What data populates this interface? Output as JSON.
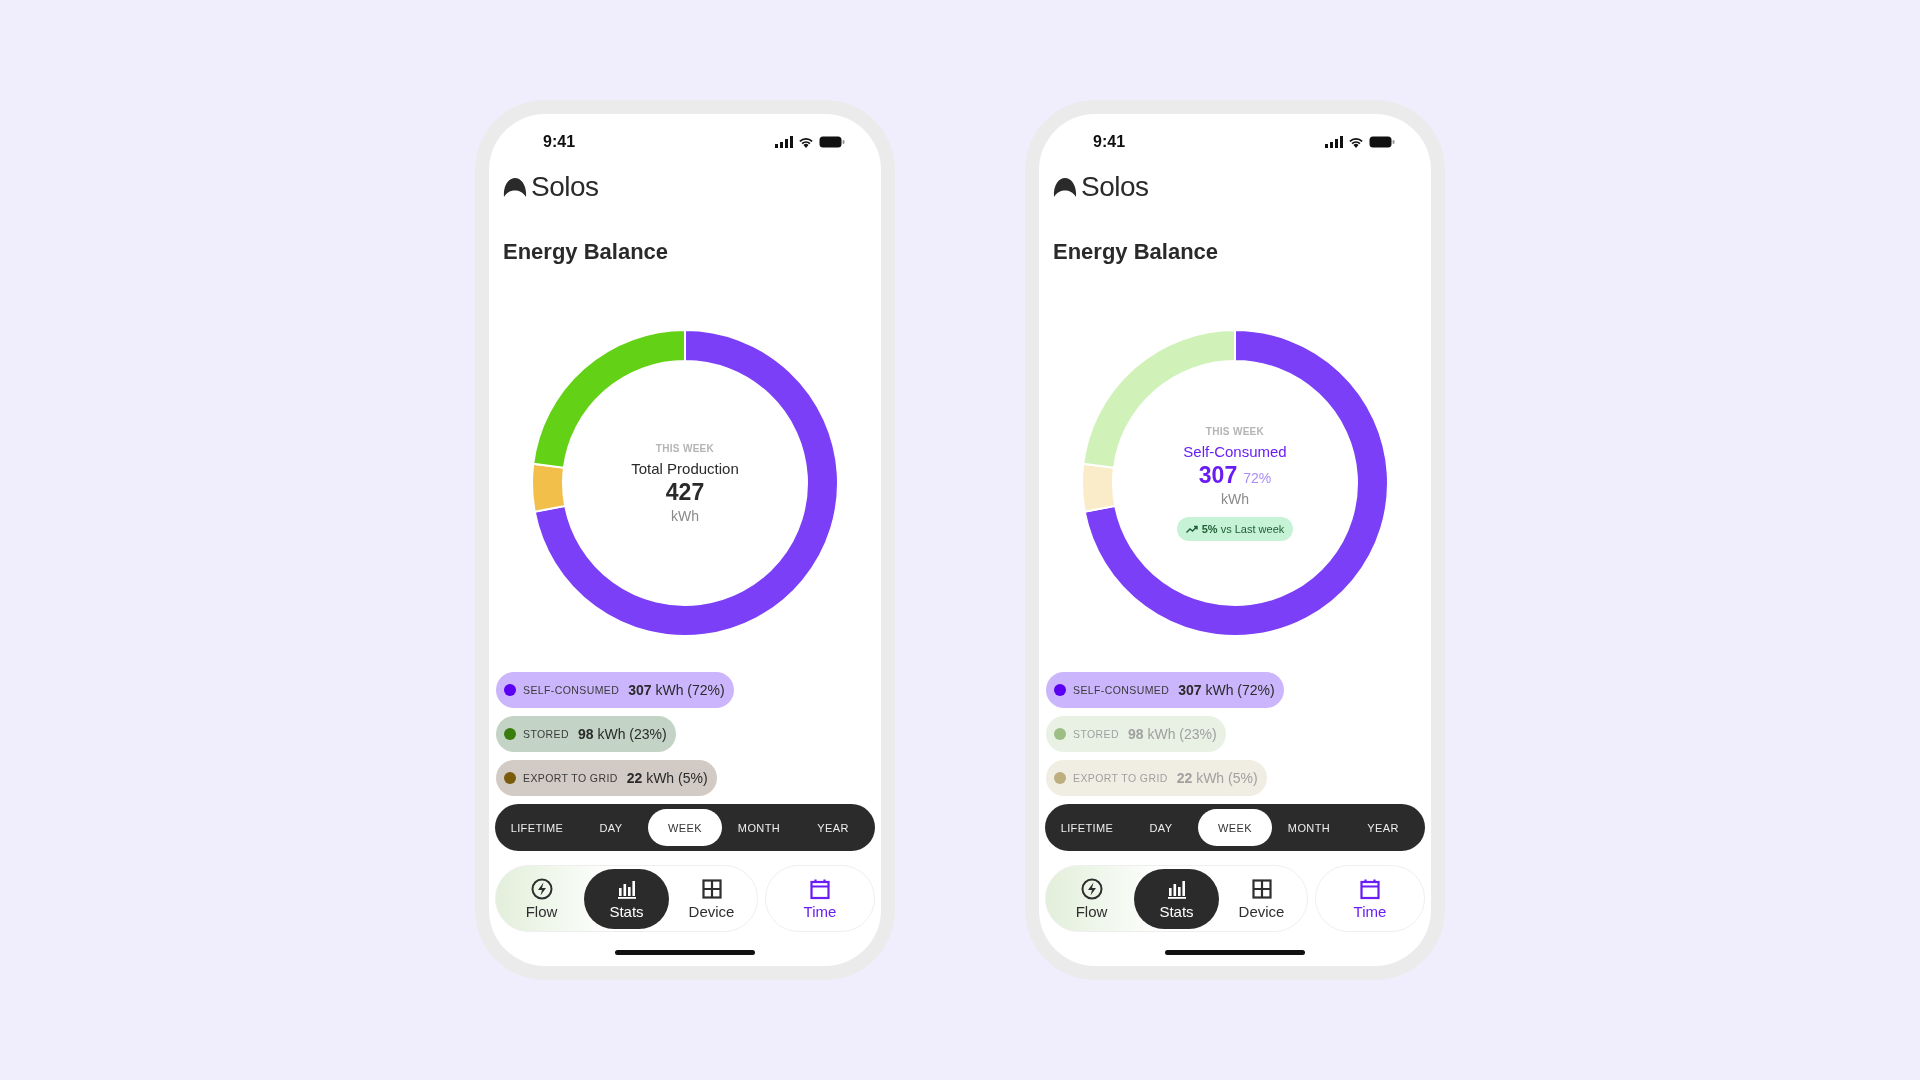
{
  "phones": [
    {
      "status_bar": {
        "time": "9:41"
      },
      "app": {
        "name": "Solos"
      },
      "title": "Energy Balance",
      "chart_data": {
        "type": "donut",
        "values": [
          72,
          5,
          23
        ],
        "colors": [
          "#7b3ff7",
          "#f2bf4b",
          "#63d115"
        ]
      },
      "slices": [
        {
          "dimmed": false
        },
        {
          "dimmed": false
        },
        {
          "dimmed": false
        }
      ],
      "center": {
        "kind": "total",
        "caption": "THIS WEEK",
        "label": "Total Production",
        "value": "427",
        "unit": "kWh"
      },
      "legend": [
        {
          "label": "SELF-CONSUMED",
          "value": "307 kWh (72%)",
          "color": "#5b00f2",
          "dimmed": false
        },
        {
          "label": "STORED",
          "value": "98 kWh (23%)",
          "color": "#3a7d0f",
          "dimmed": false
        },
        {
          "label": "EXPORT TO GRID",
          "value": "22 kWh (5%)",
          "color": "#7a5a0b",
          "dimmed": false
        }
      ],
      "periods": [
        {
          "label": "LIFETIME",
          "selected": false
        },
        {
          "label": "DAY",
          "selected": false
        },
        {
          "label": "WEEK",
          "selected": true
        },
        {
          "label": "MONTH",
          "selected": false
        },
        {
          "label": "YEAR",
          "selected": false
        }
      ],
      "nav": [
        {
          "kind": "flow",
          "label": "Flow",
          "selected": false
        },
        {
          "kind": "stats",
          "label": "Stats",
          "selected": true
        },
        {
          "kind": "device",
          "label": "Device",
          "selected": false
        },
        {
          "kind": "time",
          "label": "Time",
          "selected": false
        }
      ]
    },
    {
      "status_bar": {
        "time": "9:41"
      },
      "app": {
        "name": "Solos"
      },
      "title": "Energy Balance",
      "chart_data": {
        "type": "donut",
        "values": [
          72,
          5,
          23
        ],
        "colors": [
          "#7b3ff7",
          "#f2bf4b",
          "#63d115"
        ]
      },
      "slices": [
        {
          "dimmed": false
        },
        {
          "dimmed": true
        },
        {
          "dimmed": true
        }
      ],
      "center": {
        "kind": "category",
        "caption": "THIS WEEK",
        "label": "Self-Consumed",
        "value": "307",
        "percent": "72%",
        "unit": "kWh",
        "trend": "**5%** vs Last week"
      },
      "legend": [
        {
          "label": "SELF-CONSUMED",
          "value": "307 kWh (72%)",
          "color": "#5b00f2",
          "dimmed": false
        },
        {
          "label": "STORED",
          "value": "98 kWh (23%)",
          "color": "#9dbf86",
          "dimmed": true
        },
        {
          "label": "EXPORT TO GRID",
          "value": "22 kWh (5%)",
          "color": "#bdae80",
          "dimmed": true
        }
      ],
      "periods": [
        {
          "label": "LIFETIME",
          "selected": false
        },
        {
          "label": "DAY",
          "selected": false
        },
        {
          "label": "WEEK",
          "selected": true
        },
        {
          "label": "MONTH",
          "selected": false
        },
        {
          "label": "YEAR",
          "selected": false
        }
      ],
      "nav": [
        {
          "kind": "flow",
          "label": "Flow",
          "selected": false
        },
        {
          "kind": "stats",
          "label": "Stats",
          "selected": true
        },
        {
          "kind": "device",
          "label": "Device",
          "selected": false
        },
        {
          "kind": "time",
          "label": "Time",
          "selected": false
        }
      ]
    }
  ]
}
